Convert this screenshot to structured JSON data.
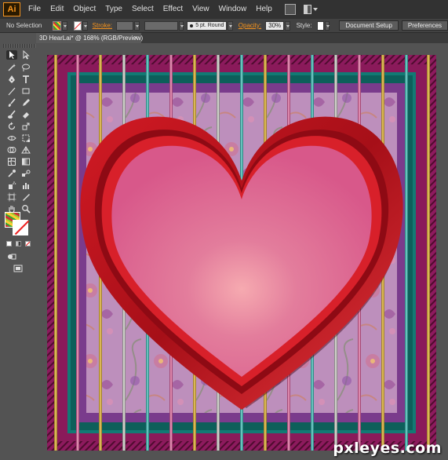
{
  "app": {
    "logo": "Ai",
    "menu": [
      "File",
      "Edit",
      "Object",
      "Type",
      "Select",
      "Effect",
      "View",
      "Window",
      "Help"
    ]
  },
  "control_bar": {
    "selection_label": "No Selection",
    "stroke_label": "Stroke:",
    "brush_label": "5 pt. Round",
    "opacity_label": "Opacity:",
    "opacity_value": "30%",
    "style_label": "Style:",
    "document_setup_label": "Document Setup",
    "preferences_label": "Preferences"
  },
  "document": {
    "tab_title": "3D HearLai* @ 168% (RGB/Preview)",
    "tab_close": "×"
  },
  "artwork": {
    "colors": {
      "heart_fill": "#e06894",
      "heart_highlight": "#f6aab0",
      "heart_border": "#c0141e",
      "frame_magenta": "#8a1a5a",
      "frame_teal": "#127a74",
      "frame_purple": "#7a3b8c",
      "inner_panel": "#b789b1"
    }
  },
  "watermark": "pxleyes.com"
}
